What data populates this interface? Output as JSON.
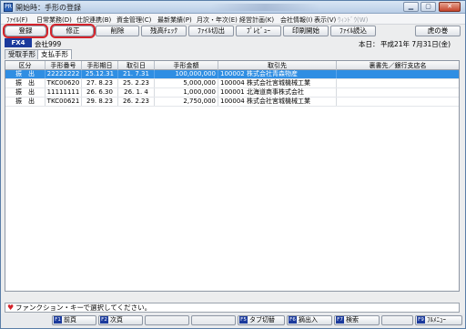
{
  "window": {
    "title": "開始時：手形の登録",
    "app_icon_text": "PR"
  },
  "menu": [
    {
      "label": "ﾌｧｲﾙ(F)",
      "disabled": false
    },
    {
      "label": "日常業務(D)",
      "disabled": false
    },
    {
      "label": "仕訳連携(B)",
      "disabled": false
    },
    {
      "label": "資金管理(C)",
      "disabled": false
    },
    {
      "label": "最新業績(P)",
      "disabled": false
    },
    {
      "label": "月次・年次(E)",
      "disabled": false
    },
    {
      "label": "経営計画(K)",
      "disabled": false
    },
    {
      "label": "会社情報(I)",
      "disabled": false
    },
    {
      "label": "表示(V)",
      "disabled": false
    },
    {
      "label": "ｳｨﾝﾄﾞｳ(W)",
      "disabled": true
    }
  ],
  "toolbar": {
    "register": "登録",
    "modify": "修正",
    "delete": "削除",
    "balance_check": "残高ﾁｪｯｸ",
    "file_export": "ﾌｧｲﾙ切出",
    "preview": "ﾌﾟﾚﾋﾞｭｰ",
    "print_start": "印刷開始",
    "file_import": "ﾌｧｲﾙ読込",
    "tora_no_maki": "虎の巻"
  },
  "company": {
    "fx_badge": "FX4",
    "name": "会社999",
    "today_label": "本日：",
    "today_date": "平成21年 7月31日(金)"
  },
  "tabs": [
    {
      "label": "受取手形",
      "active": false
    },
    {
      "label": "支払手形",
      "active": true
    }
  ],
  "table": {
    "columns": [
      "区分",
      "手形番号",
      "手形期日",
      "取引日",
      "手形金額",
      "取引先",
      "裏書先／銀行支店名"
    ],
    "rows": [
      {
        "kubun": "振　出",
        "number": "22222222",
        "due": "25.12.31",
        "trade_date": "21. 7.31",
        "amount": "100,000,000",
        "partner": "100002 株式会社青森物産",
        "endorse": "",
        "selected": true
      },
      {
        "kubun": "振　出",
        "number": "TKC00620",
        "due": "27. 8.23",
        "trade_date": "25. 2.23",
        "amount": "5,000,000",
        "partner": "100004 株式会社宮城機械工業",
        "endorse": "",
        "selected": false
      },
      {
        "kubun": "振　出",
        "number": "11111111",
        "due": "26. 6.30",
        "trade_date": "26. 1. 4",
        "amount": "1,000,000",
        "partner": "100001 北海道商事株式会社",
        "endorse": "",
        "selected": false
      },
      {
        "kubun": "振　出",
        "number": "TKC00621",
        "due": "29. 8.23",
        "trade_date": "26. 2.23",
        "amount": "2,750,000",
        "partner": "100004 株式会社宮城機械工業",
        "endorse": "",
        "selected": false
      }
    ]
  },
  "status": {
    "message": "ファンクション・キーで選択してください。"
  },
  "fkeys": [
    {
      "num": "F1",
      "label": "前頁"
    },
    {
      "num": "F2",
      "label": "次頁"
    },
    {
      "num": "",
      "label": ""
    },
    {
      "num": "",
      "label": ""
    },
    {
      "num": "F5",
      "label": "タブ切替"
    },
    {
      "num": "F6",
      "label": "摘出入"
    },
    {
      "num": "F7",
      "label": "検索"
    },
    {
      "num": "",
      "label": ""
    },
    {
      "num": "F9",
      "label": "ﾌﾙﾒﾆｭｰ"
    }
  ],
  "colors": {
    "selected_row": "#2f8ee3",
    "highlight_outline": "#d4232b",
    "badge": "#1b3a9c"
  }
}
